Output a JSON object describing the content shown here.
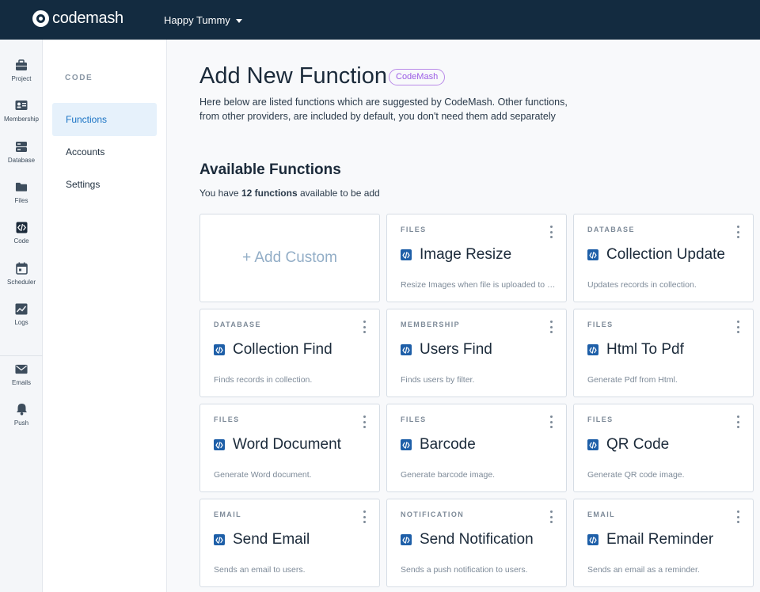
{
  "topbar": {
    "logo_text": "codemash",
    "project_name": "Happy Tummy"
  },
  "rail": {
    "items": [
      {
        "label": "Project",
        "icon": "briefcase-icon"
      },
      {
        "label": "Membership",
        "icon": "id-card-icon"
      },
      {
        "label": "Database",
        "icon": "database-icon"
      },
      {
        "label": "Files",
        "icon": "folder-icon"
      },
      {
        "label": "Code",
        "icon": "code-icon"
      },
      {
        "label": "Scheduler",
        "icon": "calendar-icon"
      },
      {
        "label": "Logs",
        "icon": "chart-icon"
      },
      {
        "label": "Emails",
        "icon": "envelope-icon"
      },
      {
        "label": "Push",
        "icon": "bell-icon"
      }
    ]
  },
  "subnav": {
    "heading": "CODE",
    "items": [
      {
        "label": "Functions",
        "active": true
      },
      {
        "label": "Accounts",
        "active": false
      },
      {
        "label": "Settings",
        "active": false
      }
    ]
  },
  "main": {
    "title": "Add New Function",
    "badge": "CodeMash",
    "intro": "Here below are listed functions which are suggested by CodeMash. Other functions, from other providers, are included by default, you don't need them add separately",
    "section_title": "Available Functions",
    "count_prefix": "You have ",
    "count_bold": "12 functions",
    "count_suffix": " available to be add",
    "add_custom_label": "+ Add Custom",
    "cards": [
      {
        "category": "FILES",
        "name": "Image Resize",
        "description": "Resize Images when file is uploaded to storage."
      },
      {
        "category": "DATABASE",
        "name": "Collection Update",
        "description": "Updates records in collection."
      },
      {
        "category": "DATABASE",
        "name": "Collection Find",
        "description": "Finds records in collection."
      },
      {
        "category": "MEMBERSHIP",
        "name": "Users Find",
        "description": "Finds users by filter."
      },
      {
        "category": "FILES",
        "name": "Html To Pdf",
        "description": "Generate Pdf from Html."
      },
      {
        "category": "FILES",
        "name": "Word Document",
        "description": "Generate Word document."
      },
      {
        "category": "FILES",
        "name": "Barcode",
        "description": "Generate barcode image."
      },
      {
        "category": "FILES",
        "name": "QR Code",
        "description": "Generate QR code image."
      },
      {
        "category": "EMAIL",
        "name": "Send Email",
        "description": "Sends an email to users."
      },
      {
        "category": "NOTIFICATION",
        "name": "Send Notification",
        "description": "Sends a push notification to users."
      },
      {
        "category": "EMAIL",
        "name": "Email Reminder",
        "description": "Sends an email as a reminder."
      }
    ]
  },
  "colors": {
    "topbar_bg": "#132b40",
    "accent": "#1a73c4",
    "badge": "#9b5de5",
    "code_icon": "#1e5fa8"
  }
}
